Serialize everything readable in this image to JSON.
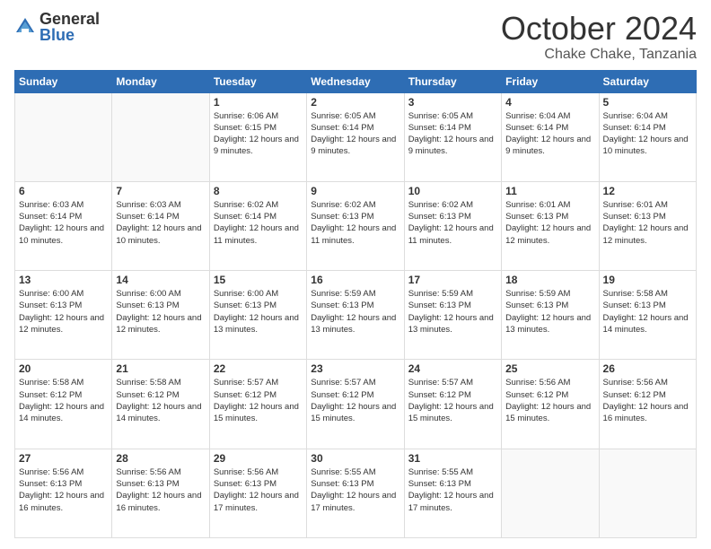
{
  "logo": {
    "general": "General",
    "blue": "Blue"
  },
  "header": {
    "month": "October 2024",
    "location": "Chake Chake, Tanzania"
  },
  "weekdays": [
    "Sunday",
    "Monday",
    "Tuesday",
    "Wednesday",
    "Thursday",
    "Friday",
    "Saturday"
  ],
  "weeks": [
    [
      {
        "day": "",
        "info": ""
      },
      {
        "day": "",
        "info": ""
      },
      {
        "day": "1",
        "info": "Sunrise: 6:06 AM\nSunset: 6:15 PM\nDaylight: 12 hours and 9 minutes."
      },
      {
        "day": "2",
        "info": "Sunrise: 6:05 AM\nSunset: 6:14 PM\nDaylight: 12 hours and 9 minutes."
      },
      {
        "day": "3",
        "info": "Sunrise: 6:05 AM\nSunset: 6:14 PM\nDaylight: 12 hours and 9 minutes."
      },
      {
        "day": "4",
        "info": "Sunrise: 6:04 AM\nSunset: 6:14 PM\nDaylight: 12 hours and 9 minutes."
      },
      {
        "day": "5",
        "info": "Sunrise: 6:04 AM\nSunset: 6:14 PM\nDaylight: 12 hours and 10 minutes."
      }
    ],
    [
      {
        "day": "6",
        "info": "Sunrise: 6:03 AM\nSunset: 6:14 PM\nDaylight: 12 hours and 10 minutes."
      },
      {
        "day": "7",
        "info": "Sunrise: 6:03 AM\nSunset: 6:14 PM\nDaylight: 12 hours and 10 minutes."
      },
      {
        "day": "8",
        "info": "Sunrise: 6:02 AM\nSunset: 6:14 PM\nDaylight: 12 hours and 11 minutes."
      },
      {
        "day": "9",
        "info": "Sunrise: 6:02 AM\nSunset: 6:13 PM\nDaylight: 12 hours and 11 minutes."
      },
      {
        "day": "10",
        "info": "Sunrise: 6:02 AM\nSunset: 6:13 PM\nDaylight: 12 hours and 11 minutes."
      },
      {
        "day": "11",
        "info": "Sunrise: 6:01 AM\nSunset: 6:13 PM\nDaylight: 12 hours and 12 minutes."
      },
      {
        "day": "12",
        "info": "Sunrise: 6:01 AM\nSunset: 6:13 PM\nDaylight: 12 hours and 12 minutes."
      }
    ],
    [
      {
        "day": "13",
        "info": "Sunrise: 6:00 AM\nSunset: 6:13 PM\nDaylight: 12 hours and 12 minutes."
      },
      {
        "day": "14",
        "info": "Sunrise: 6:00 AM\nSunset: 6:13 PM\nDaylight: 12 hours and 12 minutes."
      },
      {
        "day": "15",
        "info": "Sunrise: 6:00 AM\nSunset: 6:13 PM\nDaylight: 12 hours and 13 minutes."
      },
      {
        "day": "16",
        "info": "Sunrise: 5:59 AM\nSunset: 6:13 PM\nDaylight: 12 hours and 13 minutes."
      },
      {
        "day": "17",
        "info": "Sunrise: 5:59 AM\nSunset: 6:13 PM\nDaylight: 12 hours and 13 minutes."
      },
      {
        "day": "18",
        "info": "Sunrise: 5:59 AM\nSunset: 6:13 PM\nDaylight: 12 hours and 13 minutes."
      },
      {
        "day": "19",
        "info": "Sunrise: 5:58 AM\nSunset: 6:13 PM\nDaylight: 12 hours and 14 minutes."
      }
    ],
    [
      {
        "day": "20",
        "info": "Sunrise: 5:58 AM\nSunset: 6:12 PM\nDaylight: 12 hours and 14 minutes."
      },
      {
        "day": "21",
        "info": "Sunrise: 5:58 AM\nSunset: 6:12 PM\nDaylight: 12 hours and 14 minutes."
      },
      {
        "day": "22",
        "info": "Sunrise: 5:57 AM\nSunset: 6:12 PM\nDaylight: 12 hours and 15 minutes."
      },
      {
        "day": "23",
        "info": "Sunrise: 5:57 AM\nSunset: 6:12 PM\nDaylight: 12 hours and 15 minutes."
      },
      {
        "day": "24",
        "info": "Sunrise: 5:57 AM\nSunset: 6:12 PM\nDaylight: 12 hours and 15 minutes."
      },
      {
        "day": "25",
        "info": "Sunrise: 5:56 AM\nSunset: 6:12 PM\nDaylight: 12 hours and 15 minutes."
      },
      {
        "day": "26",
        "info": "Sunrise: 5:56 AM\nSunset: 6:12 PM\nDaylight: 12 hours and 16 minutes."
      }
    ],
    [
      {
        "day": "27",
        "info": "Sunrise: 5:56 AM\nSunset: 6:13 PM\nDaylight: 12 hours and 16 minutes."
      },
      {
        "day": "28",
        "info": "Sunrise: 5:56 AM\nSunset: 6:13 PM\nDaylight: 12 hours and 16 minutes."
      },
      {
        "day": "29",
        "info": "Sunrise: 5:56 AM\nSunset: 6:13 PM\nDaylight: 12 hours and 17 minutes."
      },
      {
        "day": "30",
        "info": "Sunrise: 5:55 AM\nSunset: 6:13 PM\nDaylight: 12 hours and 17 minutes."
      },
      {
        "day": "31",
        "info": "Sunrise: 5:55 AM\nSunset: 6:13 PM\nDaylight: 12 hours and 17 minutes."
      },
      {
        "day": "",
        "info": ""
      },
      {
        "day": "",
        "info": ""
      }
    ]
  ]
}
